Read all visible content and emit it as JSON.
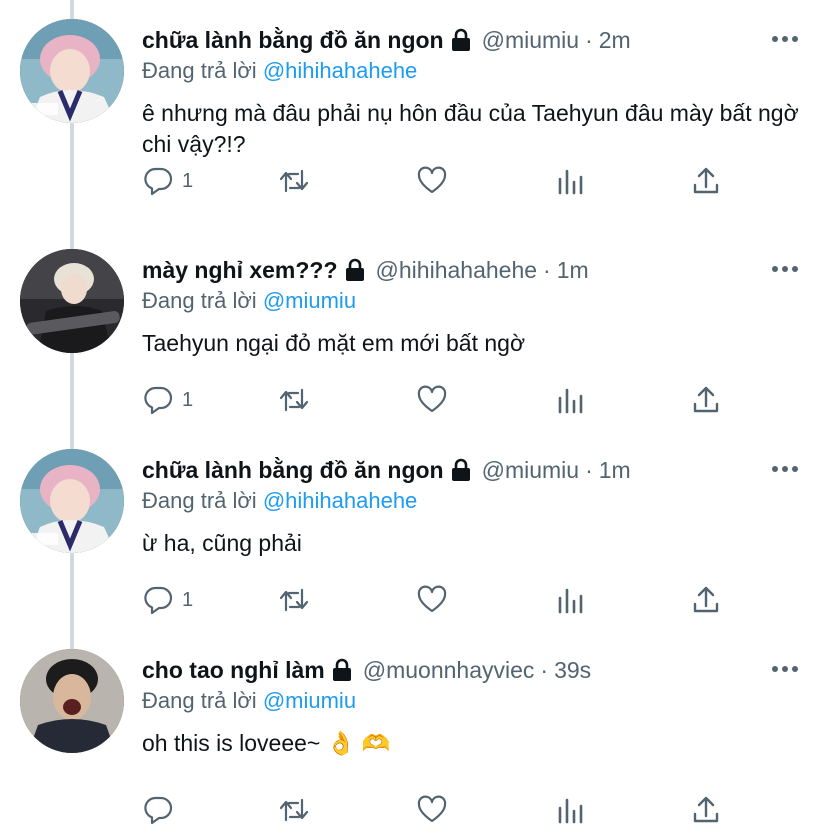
{
  "colors": {
    "link": "#1d9bf0",
    "secondary": "#536471",
    "text": "#0f1419",
    "thread_line": "#cfd9de"
  },
  "tweets": [
    {
      "name": "chữa lành bằng đồ ăn ngon",
      "handle": "@miumiu",
      "dot": "·",
      "time": "2m",
      "replying_prefix": "Đang trả lời",
      "replying_to": "@hihihahahehe",
      "text": "ê nhưng mà đâu phải nụ hôn đầu của Taehyun đâu mày bất ngờ chi vậy?!?",
      "reply_count": "1",
      "avatar": "pink-hair-person"
    },
    {
      "name": "mày nghỉ xem???",
      "handle": "@hihihahahehe",
      "dot": "·",
      "time": "1m",
      "replying_prefix": "Đang trả lời",
      "replying_to": "@miumiu",
      "text": "Taehyun ngại đỏ mặt em mới bất ngờ",
      "reply_count": "1",
      "avatar": "blonde-person-with-guitar"
    },
    {
      "name": "chữa lành bằng đồ ăn ngon",
      "handle": "@miumiu",
      "dot": "·",
      "time": "1m",
      "replying_prefix": "Đang trả lời",
      "replying_to": "@hihihahahehe",
      "text": "ừ ha, cũng phải",
      "reply_count": "1",
      "avatar": "pink-hair-person"
    },
    {
      "name": "cho tao nghỉ làm",
      "handle": "@muonnhayviec",
      "dot": "·",
      "time": "39s",
      "replying_prefix": "Đang trả lời",
      "replying_to": "@miumiu",
      "text": "oh this is loveee~ 👌 🫶",
      "reply_count": "",
      "avatar": "screaming-person"
    }
  ]
}
